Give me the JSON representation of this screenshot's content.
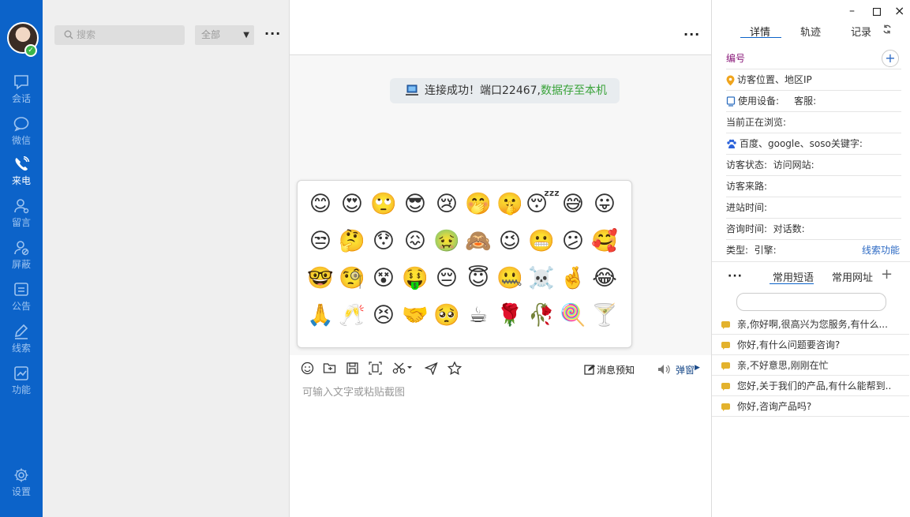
{
  "nav": {
    "items": [
      {
        "label": "会话",
        "icon": "chat-bubble-icon",
        "active": false
      },
      {
        "label": "微信",
        "icon": "wechat-bubble-icon",
        "active": false
      },
      {
        "label": "来电",
        "icon": "phone-icon",
        "active": true
      },
      {
        "label": "留言",
        "icon": "user-message-icon",
        "active": false
      },
      {
        "label": "屏蔽",
        "icon": "block-user-icon",
        "active": false
      },
      {
        "label": "公告",
        "icon": "announcement-icon",
        "active": false
      },
      {
        "label": "线索",
        "icon": "pen-icon",
        "active": false
      },
      {
        "label": "功能",
        "icon": "chart-icon",
        "active": false
      }
    ],
    "settings_label": "设置"
  },
  "list": {
    "search_placeholder": "搜索",
    "filter_value": "全部"
  },
  "chat": {
    "notice_prefix": "连接成功！端口22467,",
    "notice_highlight": "数据存至本机",
    "emojis": [
      "😊",
      "😍",
      "🙄",
      "😎",
      "😢",
      "🤭",
      "🤫",
      "😴",
      "😅",
      "😛",
      "😒",
      "🤔",
      "😯",
      "😖",
      "🤢",
      "🙈",
      "😉",
      "😬",
      "😕",
      "🥰",
      "🤓",
      "🧐",
      "😵",
      "🤑",
      "😔",
      "😇",
      "🤐",
      "☠️",
      "🤞",
      "😂",
      "🙏",
      "🥂",
      "😣",
      "🤝",
      "🥺",
      "☕",
      "🌹",
      "🥀",
      "🍭",
      "🍸"
    ],
    "toolbar": {
      "preview_label": "消息预知",
      "popup_label": "弹窗"
    },
    "input_placeholder": "可输入文字或粘贴截图"
  },
  "side": {
    "tabs": [
      "详情",
      "轨迹",
      "记录"
    ],
    "active_tab": "详情",
    "id_label": "编号",
    "rows": [
      "访客位置、地区IP",
      "使用设备:     客服:",
      "当前正在浏览:",
      "百度、google、soso关键字:",
      "访客状态:  访问网站:",
      "访客来路:",
      "进站时间:",
      "咨询时间:  对话数:",
      "类型:  引擎:"
    ],
    "clue_link": "线索功能",
    "sub_tabs": [
      "常用短语",
      "常用网址"
    ],
    "phrases": [
      "亲,你好啊,很高兴为您服务,有什么...",
      "你好,有什么问题要咨询?",
      "亲,不好意思,刚刚在忙",
      "您好,关于我们的产品,有什么能帮到..",
      "你好,咨询产品吗?"
    ]
  }
}
